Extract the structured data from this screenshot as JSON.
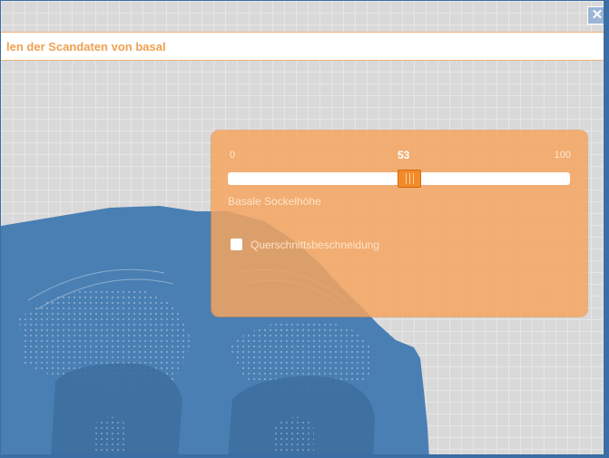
{
  "header": {
    "title": "len der Scandaten von basal",
    "close_symbol": "✕"
  },
  "panel": {
    "slider": {
      "min_label": "0",
      "max_label": "100",
      "value_label": "53",
      "min": 0,
      "max": 100,
      "value": 53,
      "label": "Basale Sockelhöhe"
    },
    "checkbox": {
      "label": "Querschnittsbeschneidung",
      "checked": false
    }
  },
  "colors": {
    "accent": "#f28a2a",
    "panel": "#f5a55f",
    "scan": "#4a7fb3",
    "frame": "#3a6ea5"
  }
}
